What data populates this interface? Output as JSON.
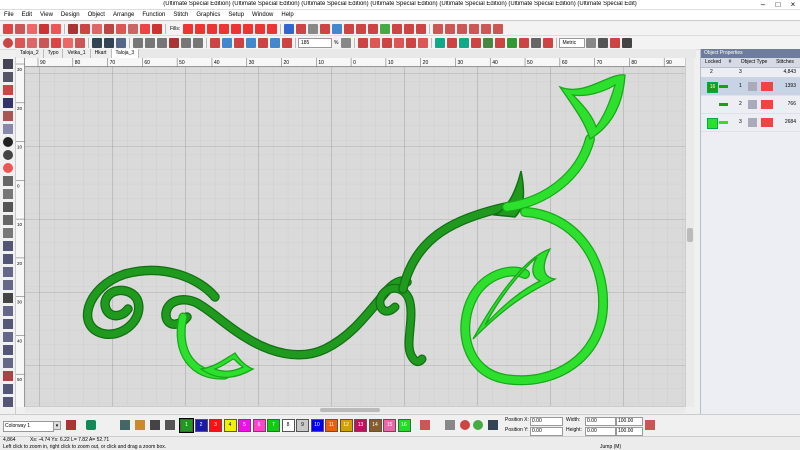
{
  "window": {
    "title": "(Ultimate Special Edition) (Ultimate Special Edition) (Ultimate Special Edition) (Ultimate Special Edition) (Ultimate Special Edition) (Ultimate Special Edition) (Ultimate Special Edit)"
  },
  "menu": [
    "File",
    "Edit",
    "View",
    "Design",
    "Object",
    "Arrange",
    "Function",
    "Stitch",
    "Graphics",
    "Setup",
    "Window",
    "Help"
  ],
  "toolbar": {
    "zoom_value": "185",
    "zoom_unit": "%",
    "units_value": "Metric",
    "fills_label": "Fills:"
  },
  "tabs": [
    "Taloja_2",
    "Typo",
    "Vetka_1",
    "Hkart",
    "Taloja_3"
  ],
  "active_tab": 4,
  "ruler_top": [
    "90",
    "80",
    "70",
    "60",
    "50",
    "40",
    "30",
    "20",
    "10",
    "0",
    "10",
    "20",
    "30",
    "40",
    "50",
    "60",
    "70",
    "80",
    "90"
  ],
  "ruler_left": [
    "30",
    "20",
    "10",
    "0",
    "10",
    "20",
    "30",
    "40",
    "50"
  ],
  "design": {
    "colors": {
      "dark": "#1f9a1f",
      "light": "#2ee02e",
      "dark_shade": "#127012",
      "light_shade": "#18a818"
    }
  },
  "object_panel": {
    "title": "Object Properties",
    "columns": [
      "Locked",
      "#",
      "Object Type",
      "Stitches"
    ],
    "summary": {
      "count1": "2",
      "count2": "3",
      "total": "4,843"
    },
    "rows": [
      {
        "num": "1",
        "stitches": "1393",
        "color": "#1f9a1f"
      },
      {
        "num": "2",
        "stitches": "766",
        "color": "#1f9a1f"
      },
      {
        "num": "3",
        "stitches": "2684",
        "color": "#2ee02e"
      }
    ]
  },
  "colorway": {
    "value": "Colorway 1",
    "swatches": [
      {
        "label": "1",
        "color": "#1f9a1f"
      },
      {
        "label": "2",
        "color": "#1a1aa8"
      },
      {
        "label": "3",
        "color": "#ff1010"
      },
      {
        "label": "4",
        "color": "#f2f200"
      },
      {
        "label": "5",
        "color": "#ee10ee"
      },
      {
        "label": "6",
        "color": "#ff44cc"
      },
      {
        "label": "7",
        "color": "#10cc10"
      },
      {
        "label": "8",
        "color": "#ffffff"
      },
      {
        "label": "9",
        "color": "#c8c8c8"
      },
      {
        "label": "10",
        "color": "#0000ee"
      },
      {
        "label": "11",
        "color": "#e86010"
      },
      {
        "label": "12",
        "color": "#d4a000"
      },
      {
        "label": "13",
        "color": "#c01060"
      },
      {
        "label": "14",
        "color": "#8b5a2b"
      },
      {
        "label": "15",
        "color": "#ee66aa"
      },
      {
        "label": "16",
        "color": "#22dd22"
      }
    ]
  },
  "position": {
    "x_label": "Position X:",
    "y_label": "Position Y:",
    "x_value": "0.00",
    "y_value": "0.00",
    "w_label": "Width:",
    "h_label": "Height:",
    "w_value": "0.00",
    "h_value": "0.00",
    "w_pct": "100.00",
    "h_pct": "100.00"
  },
  "status": {
    "stitches": "4,864",
    "coords": "Xs: -4.74 Ys: 6.22 L= 7.82 A= 52.71",
    "hint": "Left click to zoom in, right click to zoom out, or click and drag a zoom box.",
    "mode": "Jump (M)"
  }
}
